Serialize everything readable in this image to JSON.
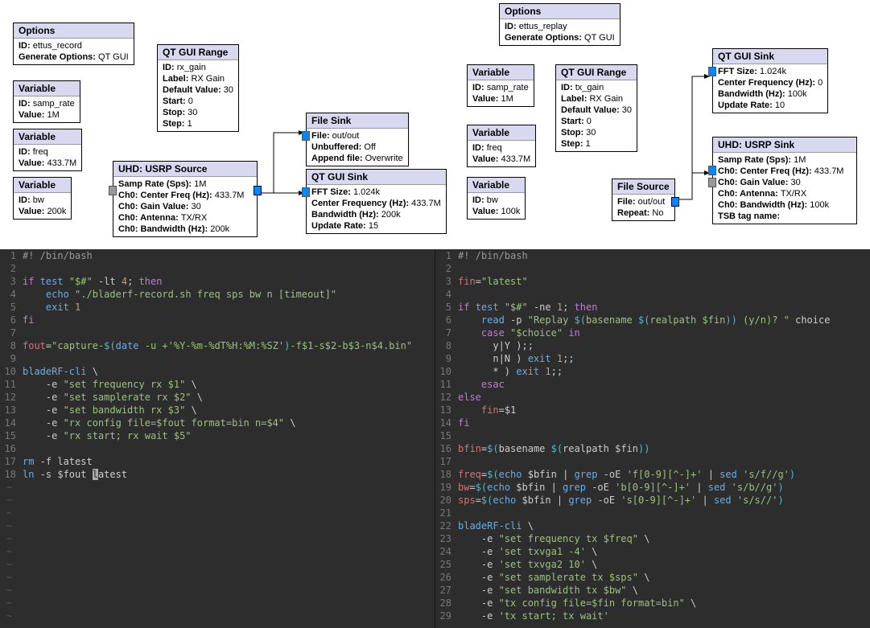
{
  "flowgraph_left": {
    "options": {
      "title": "Options",
      "id": "ettus_record",
      "gen": "QT GUI"
    },
    "var_samp": {
      "title": "Variable",
      "id": "samp_rate",
      "value": "1M"
    },
    "var_freq": {
      "title": "Variable",
      "id": "freq",
      "value": "433.7M"
    },
    "var_bw": {
      "title": "Variable",
      "id": "bw",
      "value": "200k"
    },
    "qt_range": {
      "title": "QT GUI Range",
      "id": "rx_gain",
      "label": "RX Gain",
      "default": "30",
      "start": "0",
      "stop": "30",
      "step": "1"
    },
    "usrp_src": {
      "title": "UHD: USRP Source",
      "samp": "1M",
      "cf": "433.7M",
      "gain": "30",
      "ant": "TX/RX",
      "bw": "200k"
    },
    "file_sink": {
      "title": "File Sink",
      "file": "out/out",
      "unbuffered": "Off",
      "append": "Overwrite"
    },
    "qt_sink": {
      "title": "QT GUI Sink",
      "fft": "1.024k",
      "cf": "433.7M",
      "bw": "200k",
      "update": "15"
    }
  },
  "flowgraph_right": {
    "options": {
      "title": "Options",
      "id": "ettus_replay",
      "gen": "QT GUI"
    },
    "var_samp": {
      "title": "Variable",
      "id": "samp_rate",
      "value": "1M"
    },
    "var_freq": {
      "title": "Variable",
      "id": "freq",
      "value": "433.7M"
    },
    "var_bw": {
      "title": "Variable",
      "id": "bw",
      "value": "100k"
    },
    "qt_range": {
      "title": "QT GUI Range",
      "id": "tx_gain",
      "label": "RX Gain",
      "default": "30",
      "start": "0",
      "stop": "30",
      "step": "1"
    },
    "file_src": {
      "title": "File Source",
      "file": "out/out",
      "repeat": "No"
    },
    "qt_sink": {
      "title": "QT GUI Sink",
      "fft": "1.024k",
      "cf": "0",
      "bw": "100k",
      "update": "10"
    },
    "usrp_sink": {
      "title": "UHD: USRP Sink",
      "samp": "1M",
      "cf": "433.7M",
      "gain": "30",
      "ant": "TX/RX",
      "bw": "100k",
      "tsb": ""
    }
  },
  "code_left": {
    "lines": [
      {
        "n": 1,
        "html": "<span class='c-comment'>#! /bin/bash</span>"
      },
      {
        "n": 2,
        "html": ""
      },
      {
        "n": 3,
        "html": "<span class='c-kw'>if</span> <span class='c-fn'>test</span> <span class='c-str'>\"$#\"</span> -lt <span class='c-num'>4</span>; <span class='c-kw'>then</span>"
      },
      {
        "n": 4,
        "html": "    <span class='c-fn'>echo</span> <span class='c-str'>\"./bladerf-record.sh freq sps bw n [timeout]\"</span>"
      },
      {
        "n": 5,
        "html": "    <span class='c-fn'>exit</span> <span class='c-num'>1</span>"
      },
      {
        "n": 6,
        "html": "<span class='c-kw'>fi</span>"
      },
      {
        "n": 7,
        "html": ""
      },
      {
        "n": 8,
        "html": "<span class='c-var'>fout</span>=<span class='c-str'>\"capture-<span class='c-cmd'>$(</span><span class='c-fn'>date</span> -u +<span class='c-str'>'%Y-%m-%dT%H:%M:%SZ'</span><span class='c-cmd'>)</span>-f$1-s$2-b$3-n$4.bin\"</span>"
      },
      {
        "n": 9,
        "html": ""
      },
      {
        "n": 10,
        "html": "<span class='c-fn'>bladeRF-cli</span> \\"
      },
      {
        "n": 11,
        "html": "    -e <span class='c-str'>\"set frequency rx $1\"</span> \\"
      },
      {
        "n": 12,
        "html": "    -e <span class='c-str'>\"set samplerate rx $2\"</span> \\"
      },
      {
        "n": 13,
        "html": "    -e <span class='c-str'>\"set bandwidth rx $3\"</span> \\"
      },
      {
        "n": 14,
        "html": "    -e <span class='c-str'>\"rx config file=$fout format=bin n=$4\"</span> \\"
      },
      {
        "n": 15,
        "html": "    -e <span class='c-str'>\"rx start; rx wait $5\"</span>"
      },
      {
        "n": 16,
        "html": ""
      },
      {
        "n": 17,
        "html": "<span class='c-fn'>rm</span> -f latest"
      },
      {
        "n": 18,
        "html": "<span class='c-fn'>ln</span> -s $fout <span class='cursor'>l</span>atest"
      }
    ],
    "tildes": 11
  },
  "code_right": {
    "lines": [
      {
        "n": 1,
        "html": "<span class='c-comment'>#! /bin/bash</span>"
      },
      {
        "n": 2,
        "html": ""
      },
      {
        "n": 3,
        "html": "<span class='c-var'>fin</span>=<span class='c-str'>\"latest\"</span>"
      },
      {
        "n": 4,
        "html": ""
      },
      {
        "n": 5,
        "html": "<span class='c-kw'>if</span> <span class='c-fn'>test</span> <span class='c-str'>\"$#\"</span> -ne <span class='c-num'>1</span>; <span class='c-kw'>then</span>"
      },
      {
        "n": 6,
        "html": "    <span class='c-fn'>read</span> -p <span class='c-str'>\"Replay <span class='c-cmd'>$(</span>basename <span class='c-cmd'>$(</span>realpath $fin<span class='c-cmd'>)</span><span class='c-cmd'>)</span> (y/n)? \"</span> choice"
      },
      {
        "n": 7,
        "html": "    <span class='c-kw'>case</span> <span class='c-str'>\"$choice\"</span> <span class='c-kw'>in</span>"
      },
      {
        "n": 8,
        "html": "      y|Y );;"
      },
      {
        "n": 9,
        "html": "      n|N ) <span class='c-fn'>exit</span> <span class='c-num'>1</span>;;"
      },
      {
        "n": 10,
        "html": "      * ) <span class='c-fn'>exit</span> <span class='c-num'>1</span>;;"
      },
      {
        "n": 11,
        "html": "    <span class='c-kw'>esac</span>"
      },
      {
        "n": 12,
        "html": "<span class='c-kw'>else</span>"
      },
      {
        "n": 13,
        "html": "    <span class='c-var'>fin</span>=$1"
      },
      {
        "n": 14,
        "html": "<span class='c-kw'>fi</span>"
      },
      {
        "n": 15,
        "html": ""
      },
      {
        "n": 16,
        "html": "<span class='c-var'>bfin</span>=<span class='c-cmd'>$(</span>basename <span class='c-cmd'>$(</span>realpath $fin<span class='c-cmd'>)</span><span class='c-cmd'>)</span>"
      },
      {
        "n": 17,
        "html": ""
      },
      {
        "n": 18,
        "html": "<span class='c-var'>freq</span>=<span class='c-cmd'>$(</span><span class='c-fn'>echo</span> $bfin | <span class='c-fn'>grep</span> -oE <span class='c-str'>'f[0-9][^-]+'</span> | <span class='c-fn'>sed</span> <span class='c-str'>'s/f//g'</span><span class='c-cmd'>)</span>"
      },
      {
        "n": 19,
        "html": "<span class='c-var'>bw</span>=<span class='c-cmd'>$(</span><span class='c-fn'>echo</span> $bfin | <span class='c-fn'>grep</span> -oE <span class='c-str'>'b[0-9][^-]+'</span> | <span class='c-fn'>sed</span> <span class='c-str'>'s/b//g'</span><span class='c-cmd'>)</span>"
      },
      {
        "n": 20,
        "html": "<span class='c-var'>sps</span>=<span class='c-cmd'>$(</span><span class='c-fn'>echo</span> $bfin | <span class='c-fn'>grep</span> -oE <span class='c-str'>'s[0-9][^-]+'</span> | <span class='c-fn'>sed</span> <span class='c-str'>'s/s//'</span><span class='c-cmd'>)</span>"
      },
      {
        "n": 21,
        "html": ""
      },
      {
        "n": 22,
        "html": "<span class='c-fn'>bladeRF-cli</span> \\"
      },
      {
        "n": 23,
        "html": "    -e <span class='c-str'>\"set frequency tx $freq\"</span> \\"
      },
      {
        "n": 24,
        "html": "    -e <span class='c-str'>'set txvga1 -4'</span> \\"
      },
      {
        "n": 25,
        "html": "    -e <span class='c-str'>'set txvga2 10'</span> \\"
      },
      {
        "n": 26,
        "html": "    -e <span class='c-str'>\"set samplerate tx $sps\"</span> \\"
      },
      {
        "n": 27,
        "html": "    -e <span class='c-str'>\"set bandwidth tx $bw\"</span> \\"
      },
      {
        "n": 28,
        "html": "    -e <span class='c-str'>\"tx config file=$fin format=bin\"</span> \\"
      },
      {
        "n": 29,
        "html": "    -e <span class='c-str'>'tx start; tx wait'</span>"
      }
    ],
    "tildes": 0
  }
}
